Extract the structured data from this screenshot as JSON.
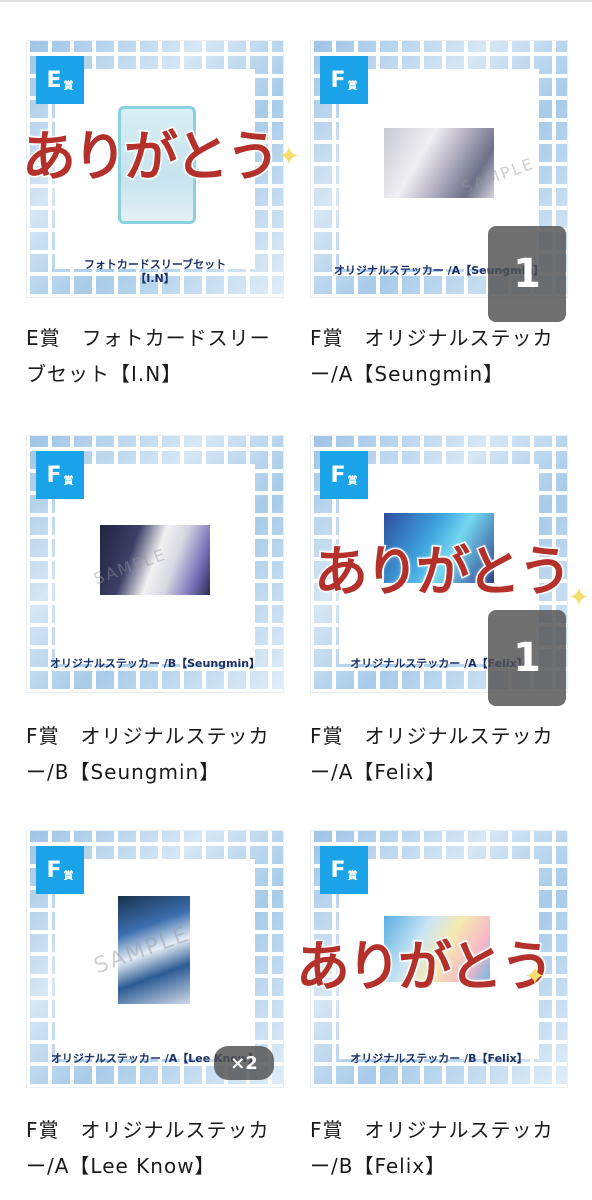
{
  "items": [
    {
      "badge_letter": "E",
      "badge_kanji": "賞",
      "thumb_caption_line1": "フォトカードスリーブセット",
      "thumb_caption_line2": "【I.N】",
      "banner": "ありがとう",
      "title": "E賞　フォトカードスリーブセット【I.N】"
    },
    {
      "badge_letter": "F",
      "badge_kanji": "賞",
      "thumb_caption_line1": "オリジナルステッカー /A【Seungmin】",
      "watermark": "SAMPLE",
      "count": "1",
      "title": "F賞　オリジナルステッカー/A【Seungmin】"
    },
    {
      "badge_letter": "F",
      "badge_kanji": "賞",
      "thumb_caption_line1": "オリジナルステッカー /B【Seungmin】",
      "watermark": "SAMPLE",
      "title": "F賞　オリジナルステッカー/B【Seungmin】"
    },
    {
      "badge_letter": "F",
      "badge_kanji": "賞",
      "thumb_caption_line1": "オリジナルステッカー /A【Felix】",
      "banner": "ありがとう",
      "count": "1",
      "title": "F賞　オリジナルステッカー/A【Felix】"
    },
    {
      "badge_letter": "F",
      "badge_kanji": "賞",
      "thumb_caption_line1": "オリジナルステッカー /A【Lee Know】",
      "watermark": "SAMPLE",
      "count": "×2",
      "title": "F賞　オリジナルステッカー/A【Lee Know】"
    },
    {
      "badge_letter": "F",
      "badge_kanji": "賞",
      "thumb_caption_line1": "オリジナルステッカー /B【Felix】",
      "banner": "ありがとう",
      "title": "F賞　オリジナルステッカー/B【Felix】"
    }
  ],
  "sparkle_icon": "✦"
}
